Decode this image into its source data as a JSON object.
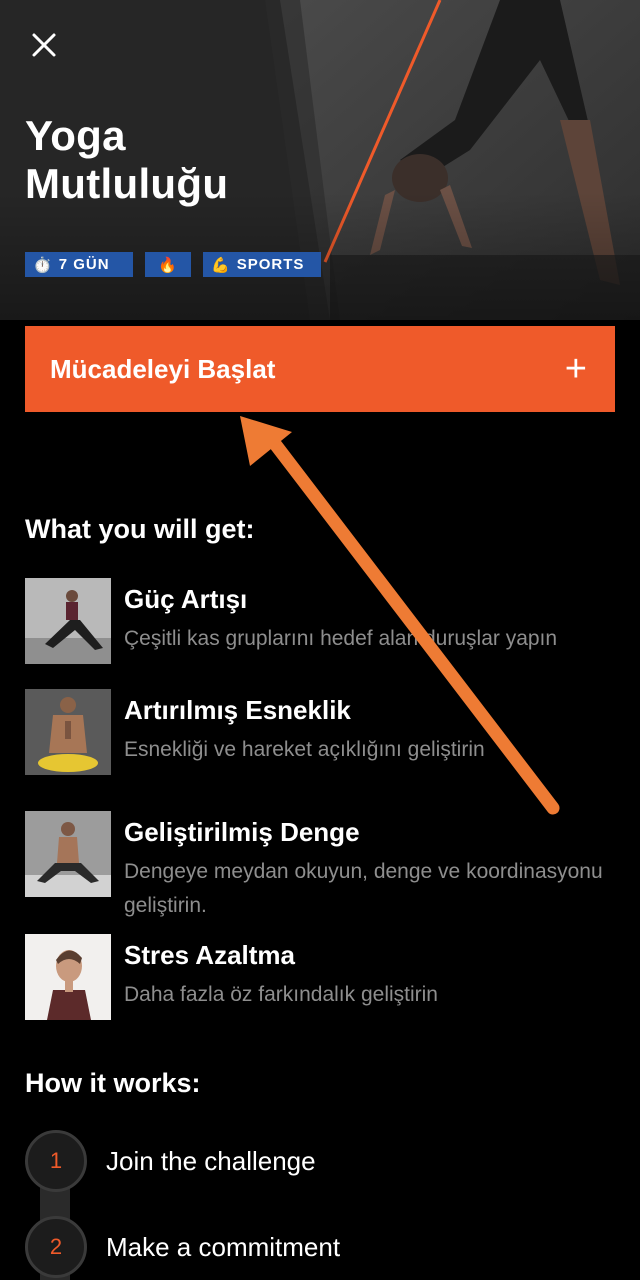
{
  "header": {
    "close_icon": "close-icon",
    "title_line1": "Yoga",
    "title_line2": "Mutluluğu",
    "badges": [
      {
        "icon": "⏱️",
        "label": "7 GÜN"
      },
      {
        "icon": "🔥",
        "label": ""
      },
      {
        "icon": "💪",
        "label": "SPORTS"
      }
    ]
  },
  "cta": {
    "label": "Mücadeleyi Başlat",
    "plus": "+"
  },
  "benefits_section": {
    "title": "What you will get:",
    "items": [
      {
        "title": "Güç Artışı",
        "description": "Çeşitli kas gruplarını hedef alan duruşlar yapın"
      },
      {
        "title": "Artırılmış Esneklik",
        "description": "Esnekliği ve hareket açıklığını geliştirin"
      },
      {
        "title": "Geliştirilmiş Denge",
        "description": "Dengeye meydan okuyun, denge ve koordinasyonu geliştirin."
      },
      {
        "title": "Stres Azaltma",
        "description": "Daha fazla öz farkındalık geliştirin"
      }
    ]
  },
  "how_section": {
    "title": "How it works:",
    "steps": [
      {
        "number": "1",
        "label": "Join the challenge"
      },
      {
        "number": "2",
        "label": "Make a commitment"
      }
    ]
  },
  "colors": {
    "accent": "#ef5a2a",
    "badge": "#2456a6",
    "background": "#000000",
    "muted_text": "#8e8e8e"
  }
}
